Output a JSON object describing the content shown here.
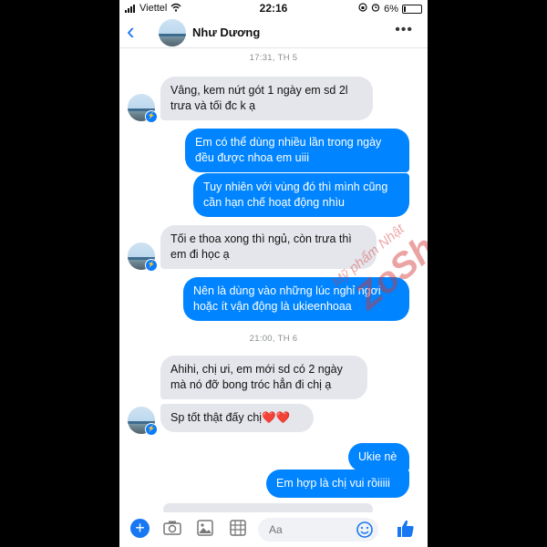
{
  "status_bar": {
    "carrier": "Viettel",
    "time": "22:16",
    "battery": "6%"
  },
  "header": {
    "contact_name": "Như Dương"
  },
  "messages": [
    {
      "type": "timestamp",
      "text": "17:31, TH 5"
    },
    {
      "type": "incoming",
      "text": "Vâng, kem nứt gót 1 ngày em sd 2l trưa và tối đc k ạ"
    },
    {
      "type": "outgoing",
      "text": "Em có thể dùng nhiều lần trong ngày đều được nhoa em uiii"
    },
    {
      "type": "outgoing",
      "text": "Tuy nhiên với vùng đó thì mình cũng cần hạn chế hoạt động nhìu"
    },
    {
      "type": "incoming",
      "text": "Tối e thoa xong thì ngủ, còn trưa thì em đi học ạ"
    },
    {
      "type": "outgoing",
      "text": "Nên là dùng vào những lúc nghỉ ngơi hoặc ít vận động là ukieenhoaa"
    },
    {
      "type": "timestamp",
      "text": "21:00, TH 6"
    },
    {
      "type": "incoming",
      "text": "Ahihi, chị ưi, em mới sd có 2 ngày mà nó đỡ bong tróc hẳn đi chị ạ"
    },
    {
      "type": "incoming",
      "text": "Sp tốt thật đấy chị❤️❤️"
    },
    {
      "type": "outgoing",
      "text": "Ukie nè"
    },
    {
      "type": "outgoing",
      "text": "Em hợp là chị vui rồiiiii"
    }
  ],
  "watermark": {
    "line1": "Mỹ phẩm Nhật",
    "line2": "ZoShop"
  },
  "composer": {
    "placeholder": "Aa"
  },
  "colors": {
    "outgoing_bubble": "#0084ff",
    "incoming_bubble": "#e4e6eb",
    "accent": "#1877f2"
  }
}
